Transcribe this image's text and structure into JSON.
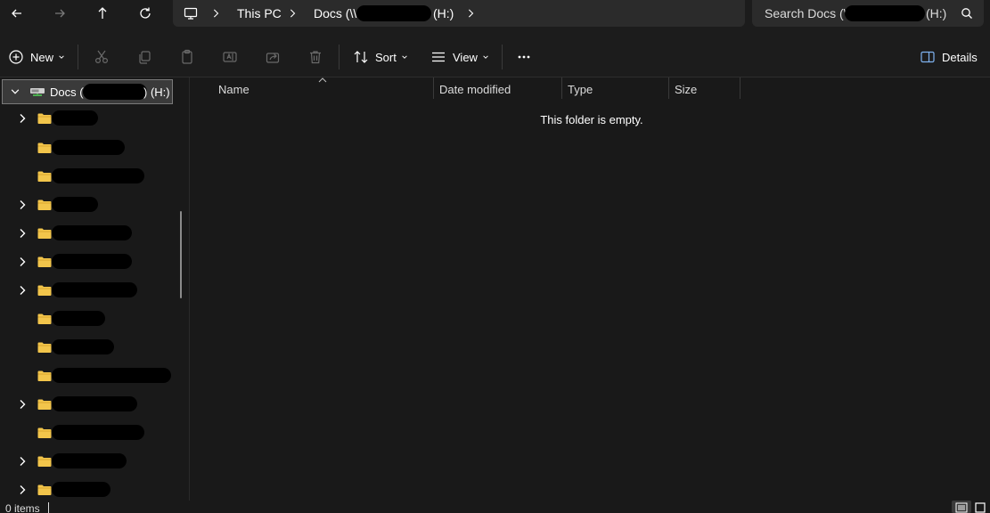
{
  "address_bar": {
    "crumbs": [
      "This PC",
      "Docs (\\\\",
      "(H:)"
    ],
    "search_prefix": "Search Docs (\\\\",
    "search_suffix": "(H:)"
  },
  "toolbar": {
    "new_label": "New",
    "sort_label": "Sort",
    "view_label": "View",
    "details_label": "Details"
  },
  "nav": {
    "root_prefix": "Docs (\\\\",
    "root_suffix": ") (H:)"
  },
  "columns": [
    "Name",
    "Date modified",
    "Type",
    "Size"
  ],
  "content": {
    "empty_message": "This folder is empty."
  },
  "status": {
    "items": "0 items"
  },
  "colors": {
    "background": "#191919",
    "folder": "#f2c54b",
    "drive": "#4caf50"
  }
}
